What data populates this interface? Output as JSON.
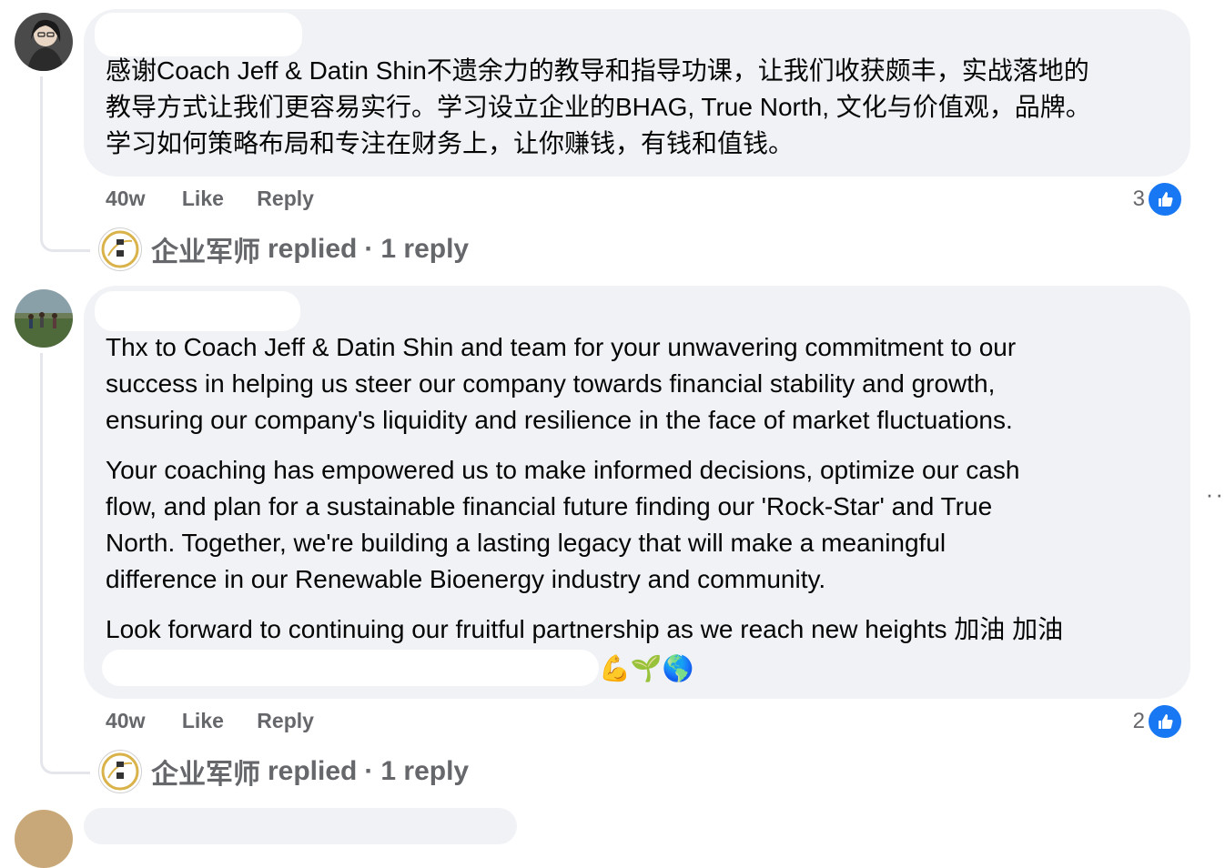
{
  "comments": [
    {
      "text_lines": [
        "感谢Coach Jeff & Datin Shin不遗余力的教导和指导功课，让我们收获颇丰，实战落地的",
        "教导方式让我们更容易实行。学习设立企业的BHAG, True North, 文化与价值观，品牌。",
        "学习如何策略布局和专注在财务上，让你赚钱，有钱和值钱。"
      ],
      "time": "40w",
      "like_label": "Like",
      "reply_label": "Reply",
      "reaction_count": "3",
      "reply_summary": {
        "name": "企业军师",
        "action": "replied",
        "separator": "·",
        "count": "1 reply"
      }
    },
    {
      "paragraphs": [
        [
          "Thx to Coach Jeff & Datin Shin and team for your unwavering commitment to our",
          "success in helping us steer our company towards financial stability and growth,",
          "ensuring our company's liquidity and resilience in the face of market fluctuations."
        ],
        [
          "Your coaching has empowered us to make informed decisions, optimize our cash",
          "flow, and plan for a sustainable financial future finding our 'Rock-Star' and True",
          "North. Together, we're building a lasting legacy that will make a meaningful",
          "difference in our Renewable Bioenergy industry and community."
        ],
        [
          "Look forward to continuing our fruitful partnership as we reach new heights 加油 加油"
        ]
      ],
      "emojis": "💪🌱🌎",
      "time": "40w",
      "like_label": "Like",
      "reply_label": "Reply",
      "reaction_count": "2",
      "reply_summary": {
        "name": "企业军师",
        "action": "replied",
        "separator": "·",
        "count": "1 reply"
      }
    }
  ],
  "more_options": "··",
  "colors": {
    "bubble": "#f0f2f5",
    "meta": "#65676b",
    "like_blue": "#1877f2"
  },
  "icons": {
    "like": "thumbs-up-icon",
    "logo": "army-advisor-logo-icon"
  }
}
